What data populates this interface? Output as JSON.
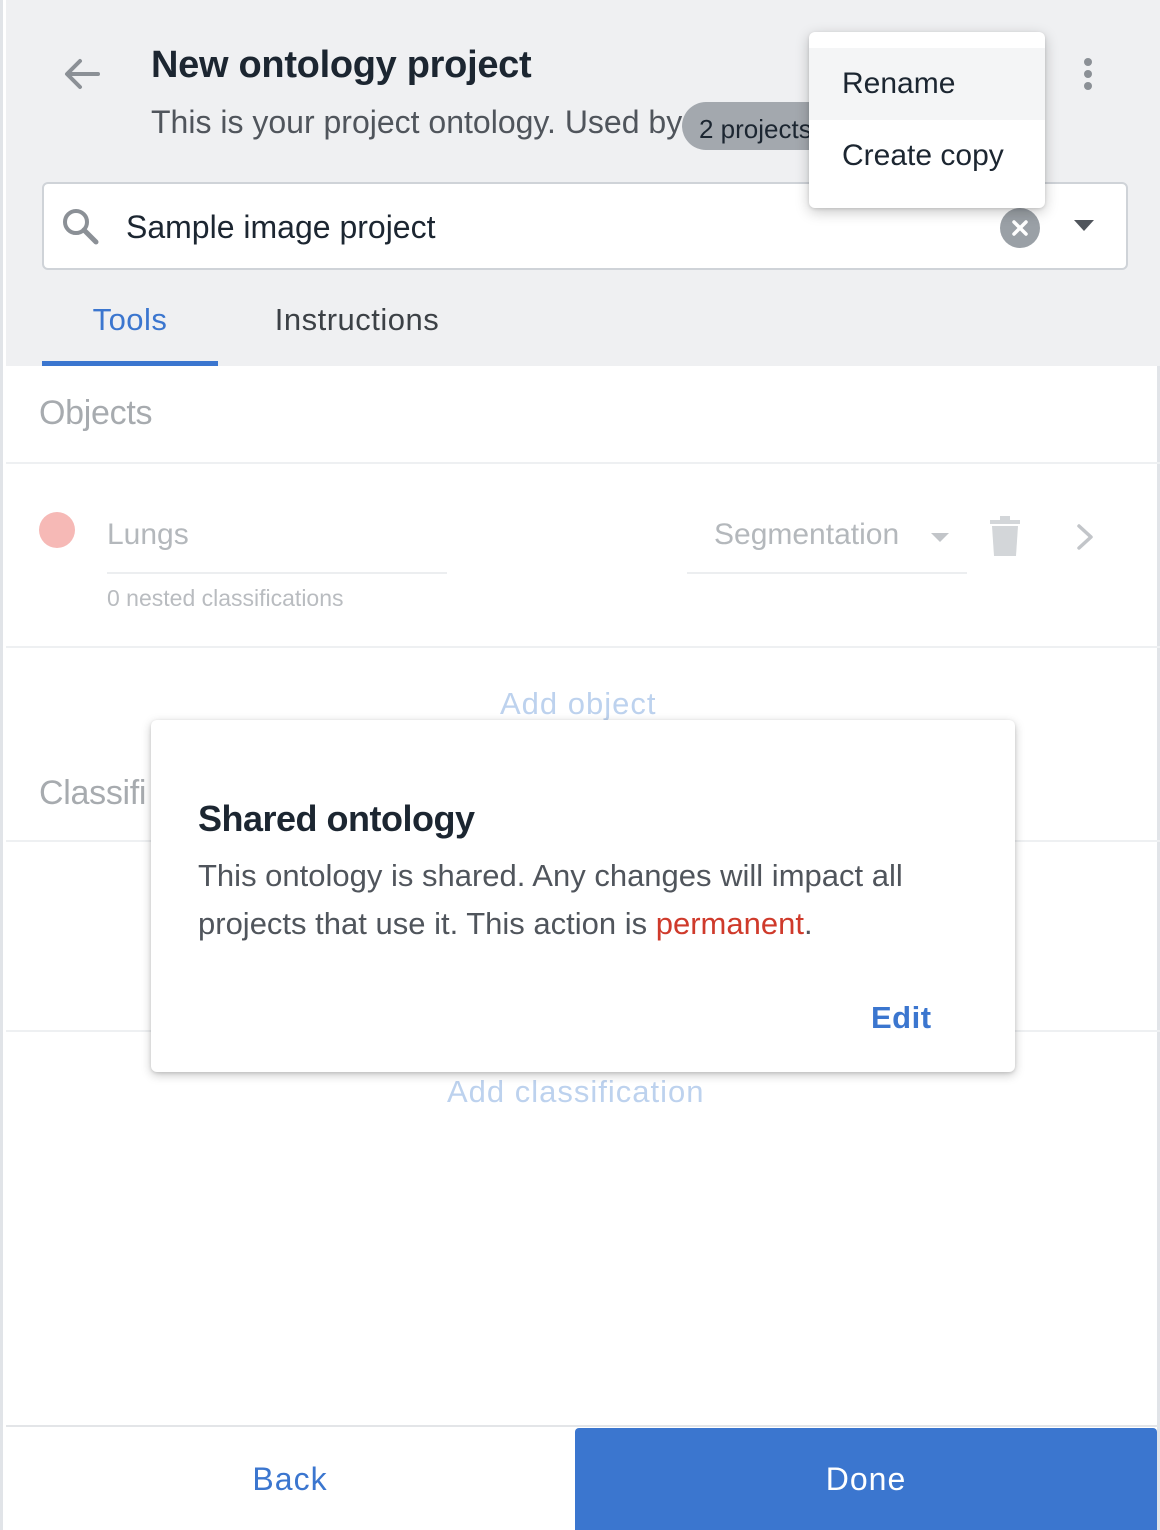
{
  "header": {
    "title": "New ontology project",
    "subtitle": "This is your project ontology. Used by",
    "usage_badge": "2 projects"
  },
  "menu": {
    "items": [
      {
        "label": "Rename"
      },
      {
        "label": "Create copy"
      }
    ]
  },
  "search": {
    "value": "Sample image project"
  },
  "tabs": [
    {
      "label": "Tools",
      "active": true
    },
    {
      "label": "Instructions",
      "active": false
    }
  ],
  "objects": {
    "section_title": "Objects",
    "items": [
      {
        "name": "Lungs",
        "color": "#f6b9b6",
        "nested": "0 nested classifications",
        "type": "Segmentation"
      }
    ],
    "add_label": "Add object"
  },
  "classifications": {
    "section_title": "Classifi",
    "add_label": "Add classification"
  },
  "dialog": {
    "title": "Shared ontology",
    "body_prefix": "This ontology is shared. Any changes will impact all projects that use it. This action is ",
    "body_warning": "permanent",
    "body_suffix": ".",
    "action_label": "Edit"
  },
  "footer": {
    "back_label": "Back",
    "done_label": "Done"
  },
  "colors": {
    "accent": "#3b76cf",
    "warning": "#cf3a2b",
    "header_bg": "#eff0f2"
  }
}
